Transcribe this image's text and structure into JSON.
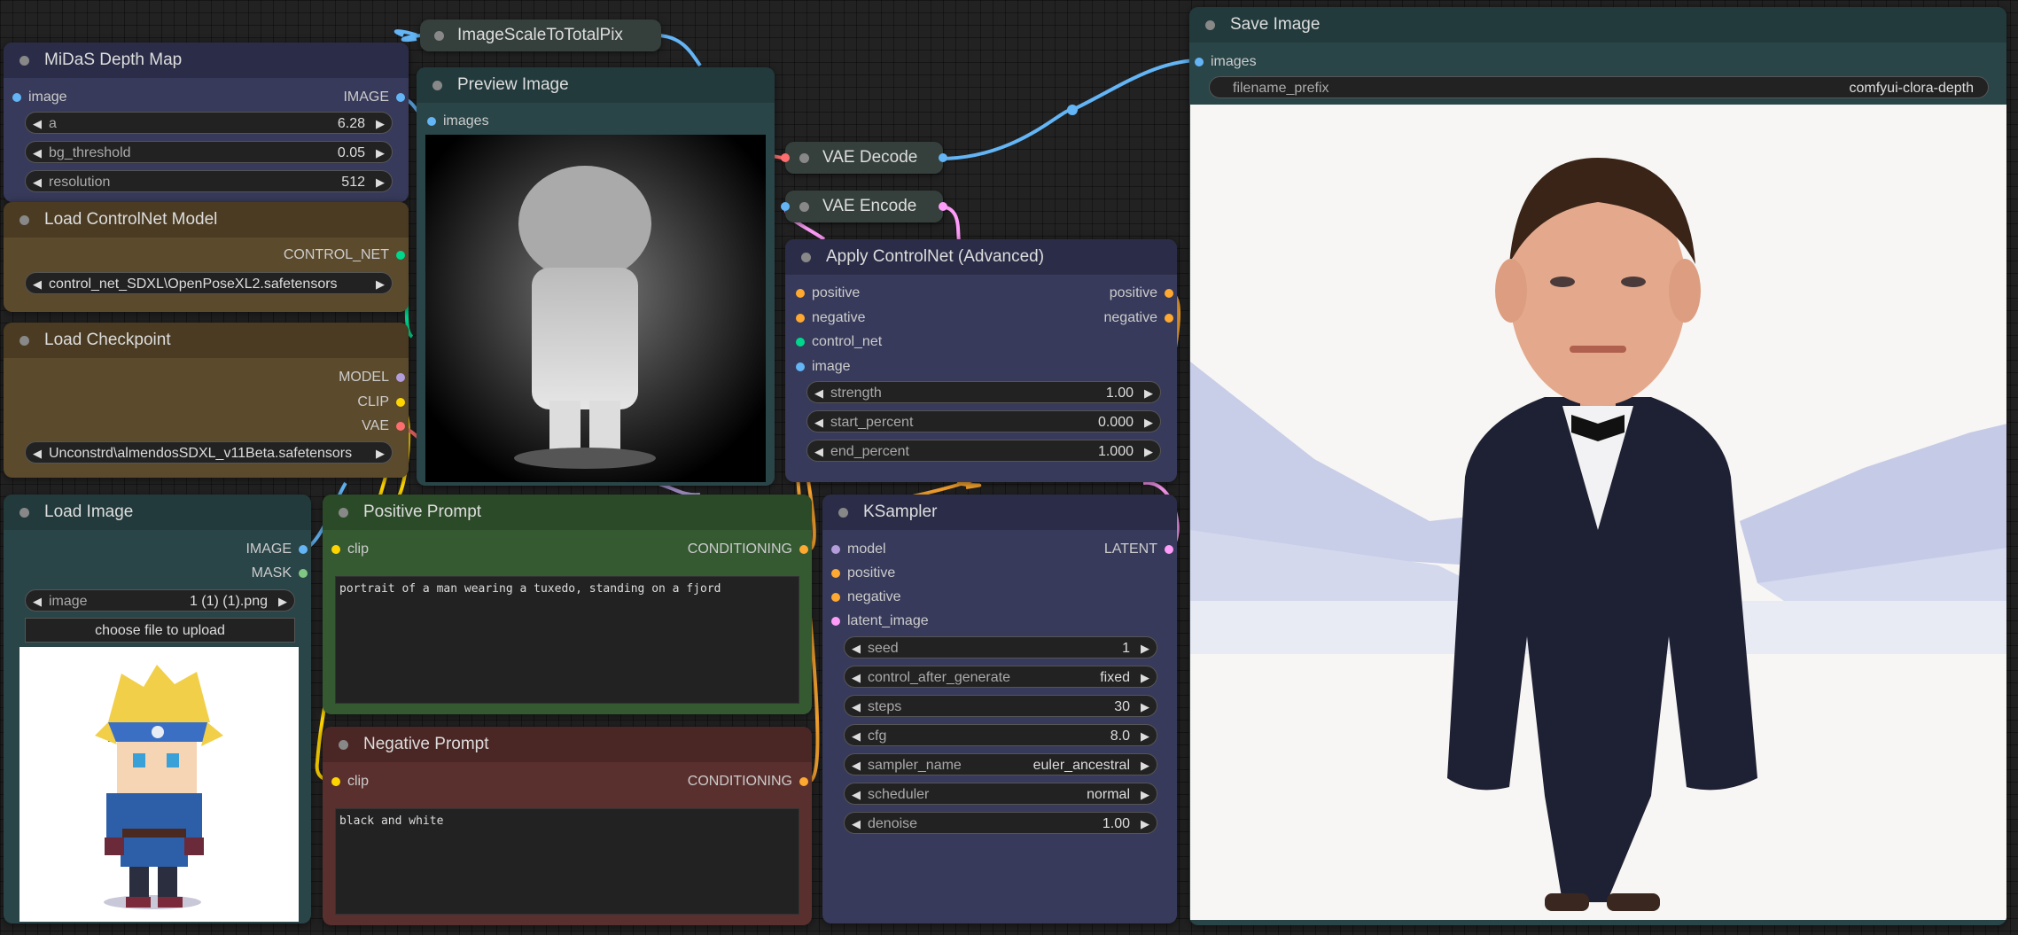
{
  "colors": {
    "image": "#64b5f6",
    "model": "#b39ddb",
    "clip": "#ffd500",
    "vae": "#ff6e6e",
    "conditioning": "#ffa931",
    "control_net": "#00d78d",
    "latent": "#ff9cf9",
    "mask": "#81c784"
  },
  "nodes": {
    "scale": {
      "title": "ImageScaleToTotalPix"
    },
    "midas": {
      "title": "MiDaS Depth Map",
      "in_image": "image",
      "out_image": "IMAGE",
      "widgets": [
        {
          "label": "a",
          "value": "6.28"
        },
        {
          "label": "bg_threshold",
          "value": "0.05"
        },
        {
          "label": "resolution",
          "value": "512"
        }
      ]
    },
    "cnet": {
      "title": "Load ControlNet Model",
      "out": "CONTROL_NET",
      "widget_text": "control_net_­SDXL\\OpenPoseXL2.safetensors"
    },
    "ckpt": {
      "title": "Load Checkpoint",
      "out_model": "MODEL",
      "out_clip": "CLIP",
      "out_vae": "VAE",
      "widget_text": "Unconstrd\\almendosSDXL_v11Beta.safetensors"
    },
    "loadimage": {
      "title": "Load Image",
      "out_image": "IMAGE",
      "out_mask": "MASK",
      "widget_label": "image",
      "widget_value": "1 (1) (1).png",
      "upload_label": "choose file to upload"
    },
    "preview": {
      "title": "Preview Image",
      "in_images": "images"
    },
    "vaedecode": {
      "title": "VAE Decode"
    },
    "vaeencode": {
      "title": "VAE Encode"
    },
    "apply": {
      "title": "Apply ControlNet (Advanced)",
      "in_positive": "positive",
      "in_negative": "negative",
      "in_control_net": "control_net",
      "in_image": "image",
      "out_positive": "positive",
      "out_negative": "negative",
      "widgets": [
        {
          "label": "strength",
          "value": "1.00"
        },
        {
          "label": "start_percent",
          "value": "0.000"
        },
        {
          "label": "end_percent",
          "value": "1.000"
        }
      ]
    },
    "positive": {
      "title": "Positive Prompt",
      "in_clip": "clip",
      "out": "CONDITIONING",
      "text": "portrait of a man wearing a tuxedo, standing on a fjord"
    },
    "negative": {
      "title": "Negative Prompt",
      "in_clip": "clip",
      "out": "CONDITIONING",
      "text": "black and white"
    },
    "ksampler": {
      "title": "KSampler",
      "in_model": "model",
      "in_positive": "positive",
      "in_negative": "negative",
      "in_latent": "latent_image",
      "out": "LATENT",
      "widgets": [
        {
          "label": "seed",
          "value": "1"
        },
        {
          "label": "control_after_generate",
          "value": "fixed"
        },
        {
          "label": "steps",
          "value": "30"
        },
        {
          "label": "cfg",
          "value": "8.0"
        },
        {
          "label": "sampler_name",
          "value": "euler_ancestral"
        },
        {
          "label": "scheduler",
          "value": "normal"
        },
        {
          "label": "denoise",
          "value": "1.00"
        }
      ]
    },
    "save": {
      "title": "Save Image",
      "in_images": "images",
      "prefix_label": "filename_prefix",
      "prefix_value": "comfyui-clora-depth"
    }
  }
}
